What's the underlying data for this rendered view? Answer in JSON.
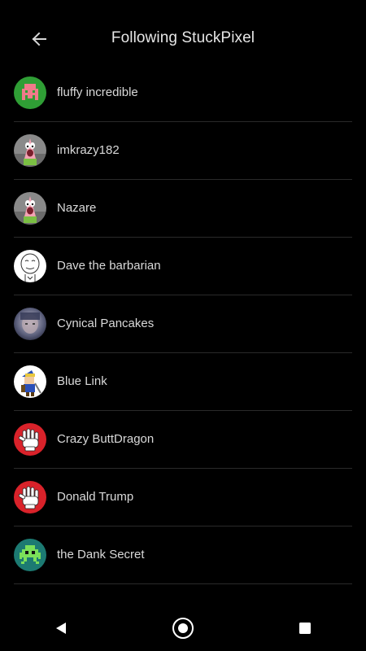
{
  "header": {
    "title": "Following StuckPixel"
  },
  "users": [
    {
      "name": "fluffy incredible",
      "avatar": "green-space-invader"
    },
    {
      "name": "imkrazy182",
      "avatar": "patrick-star"
    },
    {
      "name": "Nazare",
      "avatar": "patrick-star"
    },
    {
      "name": "Dave the barbarian",
      "avatar": "forever-alone-meme"
    },
    {
      "name": "Cynical Pancakes",
      "avatar": "photo-face"
    },
    {
      "name": "Blue Link",
      "avatar": "link-character"
    },
    {
      "name": "Crazy ButtDragon",
      "avatar": "white-glove-red"
    },
    {
      "name": "Donald Trump",
      "avatar": "white-glove-red"
    },
    {
      "name": "the Dank Secret",
      "avatar": "teal-space-invader"
    }
  ],
  "nav": {
    "back": "back-icon",
    "home": "home-icon",
    "recents": "recents-icon"
  },
  "colors": {
    "background": "#000000",
    "text": "#d9d9d9",
    "divider": "#2a2a2a",
    "invader_green_bg": "#2f9e35",
    "invader_pink": "#f07a8a",
    "glove_red": "#d9222a",
    "invader_teal_bg": "#1c7a72"
  }
}
